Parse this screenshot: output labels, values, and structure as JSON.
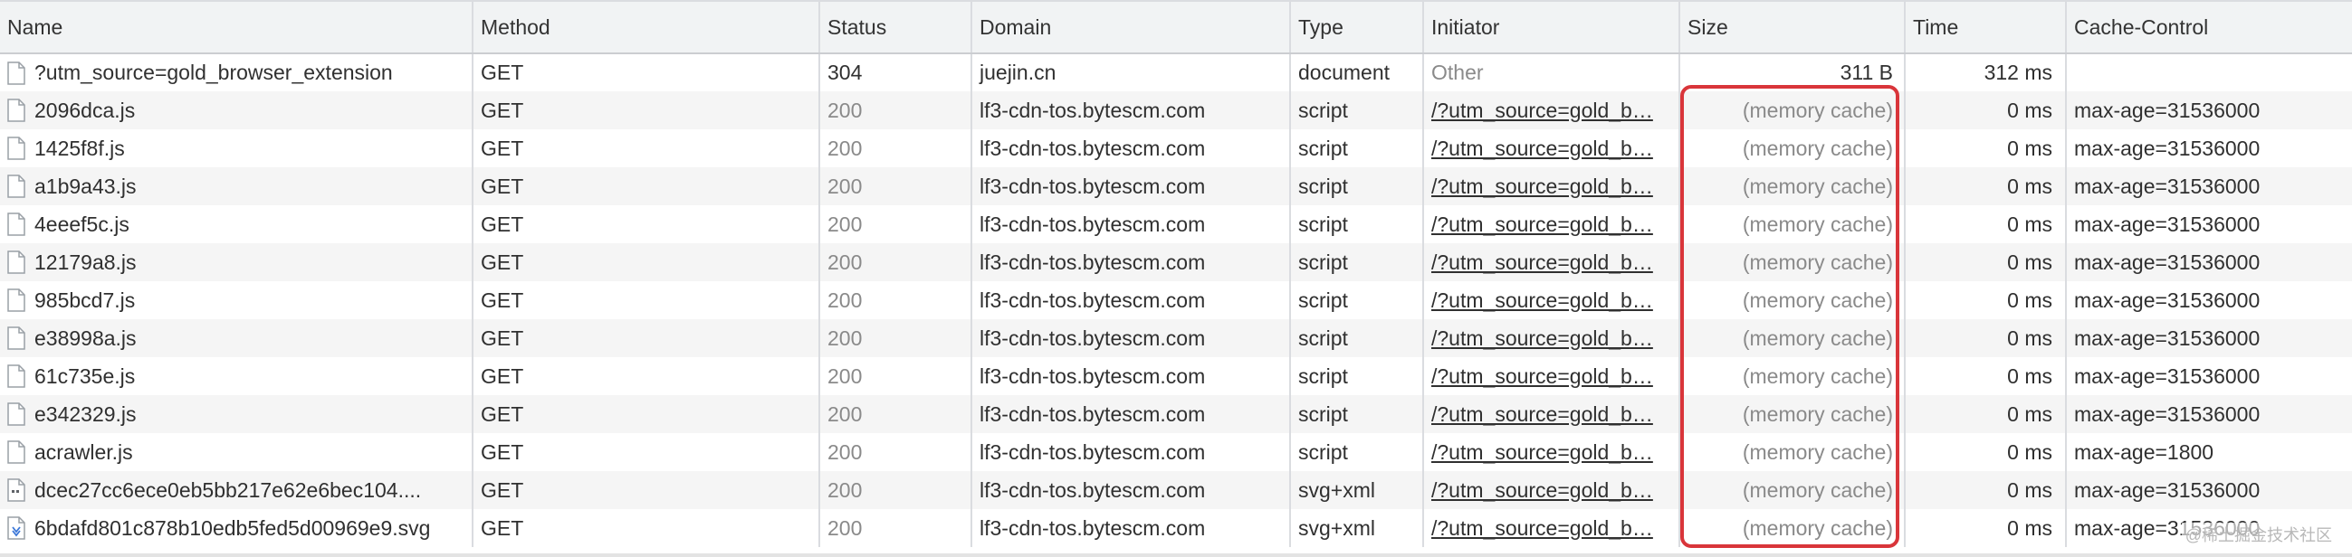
{
  "columns": [
    "Name",
    "Method",
    "Status",
    "Domain",
    "Type",
    "Initiator",
    "Size",
    "Time",
    "Cache-Control"
  ],
  "rows": [
    {
      "icon": "document-icon",
      "name": "?utm_source=gold_browser_extension",
      "method": "GET",
      "status": "304",
      "domain": "juejin.cn",
      "type": "document",
      "initiator": "Other",
      "initiator_link": false,
      "size": "311 B",
      "size_cached": false,
      "time": "312 ms",
      "cache_control": ""
    },
    {
      "icon": "document-icon",
      "name": "2096dca.js",
      "method": "GET",
      "status": "200",
      "domain": "lf3-cdn-tos.bytescm.com",
      "type": "script",
      "initiator": "/?utm_source=gold_b…",
      "initiator_link": true,
      "size": "(memory cache)",
      "size_cached": true,
      "time": "0 ms",
      "cache_control": "max-age=31536000"
    },
    {
      "icon": "document-icon",
      "name": "1425f8f.js",
      "method": "GET",
      "status": "200",
      "domain": "lf3-cdn-tos.bytescm.com",
      "type": "script",
      "initiator": "/?utm_source=gold_b…",
      "initiator_link": true,
      "size": "(memory cache)",
      "size_cached": true,
      "time": "0 ms",
      "cache_control": "max-age=31536000"
    },
    {
      "icon": "document-icon",
      "name": "a1b9a43.js",
      "method": "GET",
      "status": "200",
      "domain": "lf3-cdn-tos.bytescm.com",
      "type": "script",
      "initiator": "/?utm_source=gold_b…",
      "initiator_link": true,
      "size": "(memory cache)",
      "size_cached": true,
      "time": "0 ms",
      "cache_control": "max-age=31536000"
    },
    {
      "icon": "document-icon",
      "name": "4eeef5c.js",
      "method": "GET",
      "status": "200",
      "domain": "lf3-cdn-tos.bytescm.com",
      "type": "script",
      "initiator": "/?utm_source=gold_b…",
      "initiator_link": true,
      "size": "(memory cache)",
      "size_cached": true,
      "time": "0 ms",
      "cache_control": "max-age=31536000"
    },
    {
      "icon": "document-icon",
      "name": "12179a8.js",
      "method": "GET",
      "status": "200",
      "domain": "lf3-cdn-tos.bytescm.com",
      "type": "script",
      "initiator": "/?utm_source=gold_b…",
      "initiator_link": true,
      "size": "(memory cache)",
      "size_cached": true,
      "time": "0 ms",
      "cache_control": "max-age=31536000"
    },
    {
      "icon": "document-icon",
      "name": "985bcd7.js",
      "method": "GET",
      "status": "200",
      "domain": "lf3-cdn-tos.bytescm.com",
      "type": "script",
      "initiator": "/?utm_source=gold_b…",
      "initiator_link": true,
      "size": "(memory cache)",
      "size_cached": true,
      "time": "0 ms",
      "cache_control": "max-age=31536000"
    },
    {
      "icon": "document-icon",
      "name": "e38998a.js",
      "method": "GET",
      "status": "200",
      "domain": "lf3-cdn-tos.bytescm.com",
      "type": "script",
      "initiator": "/?utm_source=gold_b…",
      "initiator_link": true,
      "size": "(memory cache)",
      "size_cached": true,
      "time": "0 ms",
      "cache_control": "max-age=31536000"
    },
    {
      "icon": "document-icon",
      "name": "61c735e.js",
      "method": "GET",
      "status": "200",
      "domain": "lf3-cdn-tos.bytescm.com",
      "type": "script",
      "initiator": "/?utm_source=gold_b…",
      "initiator_link": true,
      "size": "(memory cache)",
      "size_cached": true,
      "time": "0 ms",
      "cache_control": "max-age=31536000"
    },
    {
      "icon": "document-icon",
      "name": "e342329.js",
      "method": "GET",
      "status": "200",
      "domain": "lf3-cdn-tos.bytescm.com",
      "type": "script",
      "initiator": "/?utm_source=gold_b…",
      "initiator_link": true,
      "size": "(memory cache)",
      "size_cached": true,
      "time": "0 ms",
      "cache_control": "max-age=31536000"
    },
    {
      "icon": "document-icon",
      "name": "acrawler.js",
      "method": "GET",
      "status": "200",
      "domain": "lf3-cdn-tos.bytescm.com",
      "type": "script",
      "initiator": "/?utm_source=gold_b…",
      "initiator_link": true,
      "size": "(memory cache)",
      "size_cached": true,
      "time": "0 ms",
      "cache_control": "max-age=1800"
    },
    {
      "icon": "image-icon",
      "name": "dcec27cc6ece0eb5bb217e62e6bec104....",
      "method": "GET",
      "status": "200",
      "domain": "lf3-cdn-tos.bytescm.com",
      "type": "svg+xml",
      "initiator": "/?utm_source=gold_b…",
      "initiator_link": true,
      "size": "(memory cache)",
      "size_cached": true,
      "time": "0 ms",
      "cache_control": "max-age=31536000"
    },
    {
      "icon": "download-image-icon",
      "name": "6bdafd801c878b10edb5fed5d00969e9.svg",
      "method": "GET",
      "status": "200",
      "domain": "lf3-cdn-tos.bytescm.com",
      "type": "svg+xml",
      "initiator": "/?utm_source=gold_b…",
      "initiator_link": true,
      "size": "(memory cache)",
      "size_cached": true,
      "time": "0 ms",
      "cache_control": "max-age=31536000"
    }
  ],
  "watermark": "@稀土掘金技术社区",
  "colors": {
    "highlight_border": "#d9353a",
    "header_bg": "#f1f3f4",
    "stripe_bg": "#f5f5f5",
    "muted_text": "#8a8a8a"
  }
}
